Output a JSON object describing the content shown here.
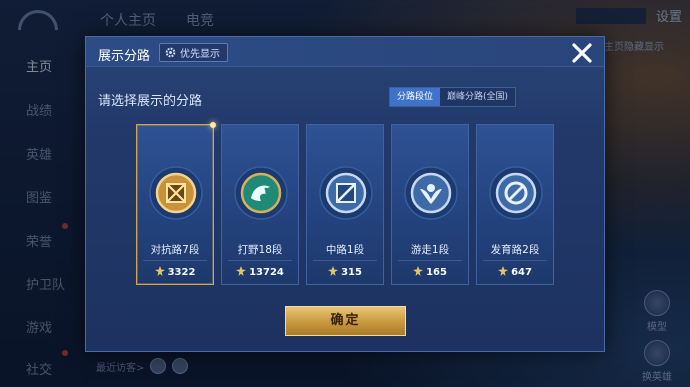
{
  "background": {
    "top_tabs": [
      "个人主页",
      "电竞"
    ],
    "settings_label": "设置",
    "left_nav": [
      "主页",
      "战绩",
      "英雄",
      "图鉴",
      "荣誉",
      "护卫队",
      "游戏",
      "社交"
    ],
    "right_edge_text": "主页隐藏显示",
    "right_buttons": [
      "模型",
      "换英雄"
    ],
    "bottom_text": "最近访客>"
  },
  "modal": {
    "title": "展示分路",
    "priority_label": "优先显示",
    "subtitle": "请选择展示的分路",
    "tabs": [
      {
        "label": "分路段位",
        "active": true
      },
      {
        "label": "巅峰分路(全国)",
        "active": false
      }
    ],
    "cards": [
      {
        "label": "对抗路7段",
        "score": "3322",
        "selected": true,
        "emblem": "clash-lane-icon",
        "color": "#d9a43c"
      },
      {
        "label": "打野18段",
        "score": "13724",
        "selected": false,
        "emblem": "jungle-dragon-icon",
        "color": "#2fa58f"
      },
      {
        "label": "中路1段",
        "score": "315",
        "selected": false,
        "emblem": "mid-lane-icon",
        "color": "#9fb9dc"
      },
      {
        "label": "游走1段",
        "score": "165",
        "selected": false,
        "emblem": "roam-icon",
        "color": "#9fb9dc"
      },
      {
        "label": "发育路2段",
        "score": "647",
        "selected": false,
        "emblem": "farm-lane-icon",
        "color": "#9fb9dc"
      }
    ],
    "confirm_label": "确定"
  },
  "colors": {
    "accent_gold": "#d4a64c",
    "tab_active": "#3f73c9"
  }
}
